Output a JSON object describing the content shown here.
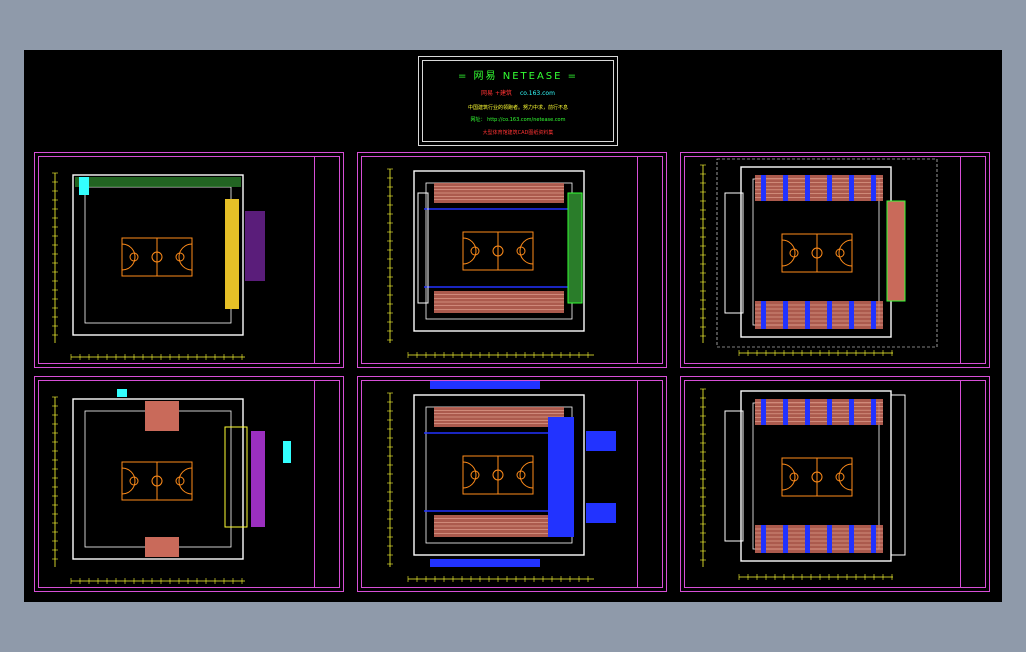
{
  "title_block": {
    "line1": "= 网易  NETEASE  =",
    "line2_a": "网易 +建筑",
    "line2_b": "co.163.com",
    "line3": "中国建筑行业的领跑者。努力中求，前行不息",
    "line4": "网址： http://co.163.com/netease.com",
    "line5": "大型体育馆建筑CAD图纸资料集"
  },
  "sheets": [
    {
      "id": "plan-1",
      "variant": "a"
    },
    {
      "id": "plan-2",
      "variant": "b"
    },
    {
      "id": "plan-3",
      "variant": "c"
    },
    {
      "id": "plan-4",
      "variant": "d"
    },
    {
      "id": "plan-5",
      "variant": "e"
    },
    {
      "id": "plan-6",
      "variant": "f"
    }
  ],
  "colors": {
    "background": "#8f9aaa",
    "canvas": "#000000",
    "frame": "#d64fd6",
    "wall": "#ffffff",
    "court": "#ff8c1a",
    "seating": "#c96a5a",
    "blue": "#2233ff",
    "cyan": "#33ffff",
    "green": "#33ff33",
    "yellow": "#ffff33"
  }
}
